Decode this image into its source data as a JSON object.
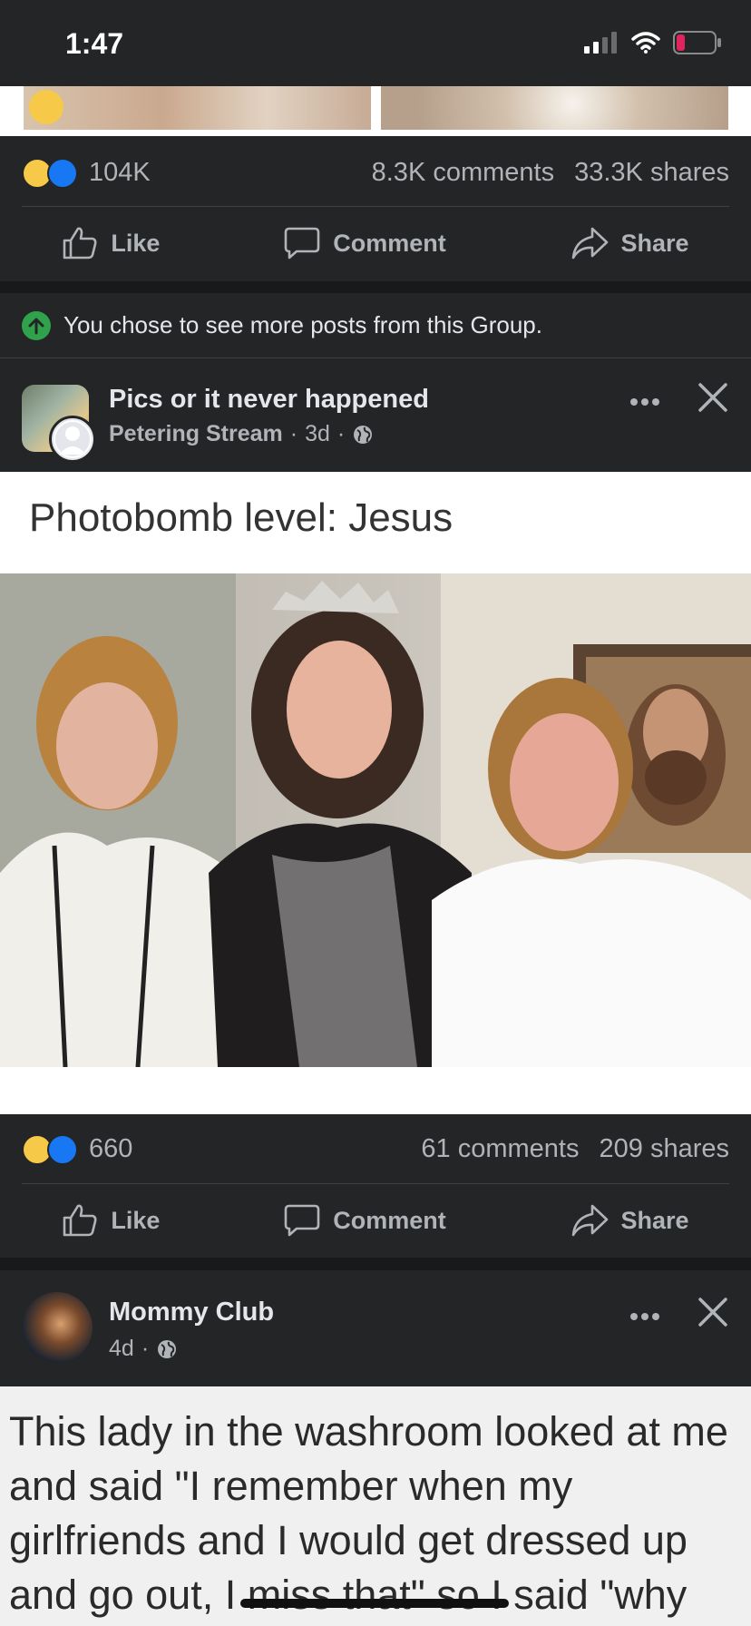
{
  "status": {
    "time": "1:47"
  },
  "post1": {
    "reaction_count": "104K",
    "comments": "8.3K comments",
    "shares": "33.3K shares"
  },
  "actions": {
    "like": "Like",
    "comment": "Comment",
    "share": "Share"
  },
  "notice": {
    "text": "You chose to see more posts from this Group."
  },
  "post2": {
    "group_name": "Pics or it never happened",
    "author": "Petering Stream",
    "time": "3d",
    "caption": "Photobomb level: Jesus",
    "reaction_count": "660",
    "comments": "61 comments",
    "shares": "209 shares"
  },
  "post3": {
    "group_name": "Mommy Club",
    "time": "4d",
    "image_text": "This lady in the washroom looked at me and said \"I remember when my girlfriends and I would get dressed up and go out, I miss that\" so I said \"why"
  },
  "separators": {
    "dot": "·"
  },
  "icons": {
    "signal": "signal-bars-icon",
    "wifi": "wifi-icon",
    "battery": "battery-low-icon",
    "like": "thumbs-up-icon",
    "comment": "comment-bubble-icon",
    "share": "share-arrow-icon",
    "globe": "globe-icon",
    "more": "more-options-icon",
    "close": "close-icon",
    "notice": "up-arrow-icon"
  },
  "colors": {
    "background": "#242526",
    "separator": "#18191a",
    "like_blue": "#1877f2",
    "haha_yellow": "#f7c948",
    "notice_green": "#31a24c",
    "battery_red": "#e0245e"
  }
}
